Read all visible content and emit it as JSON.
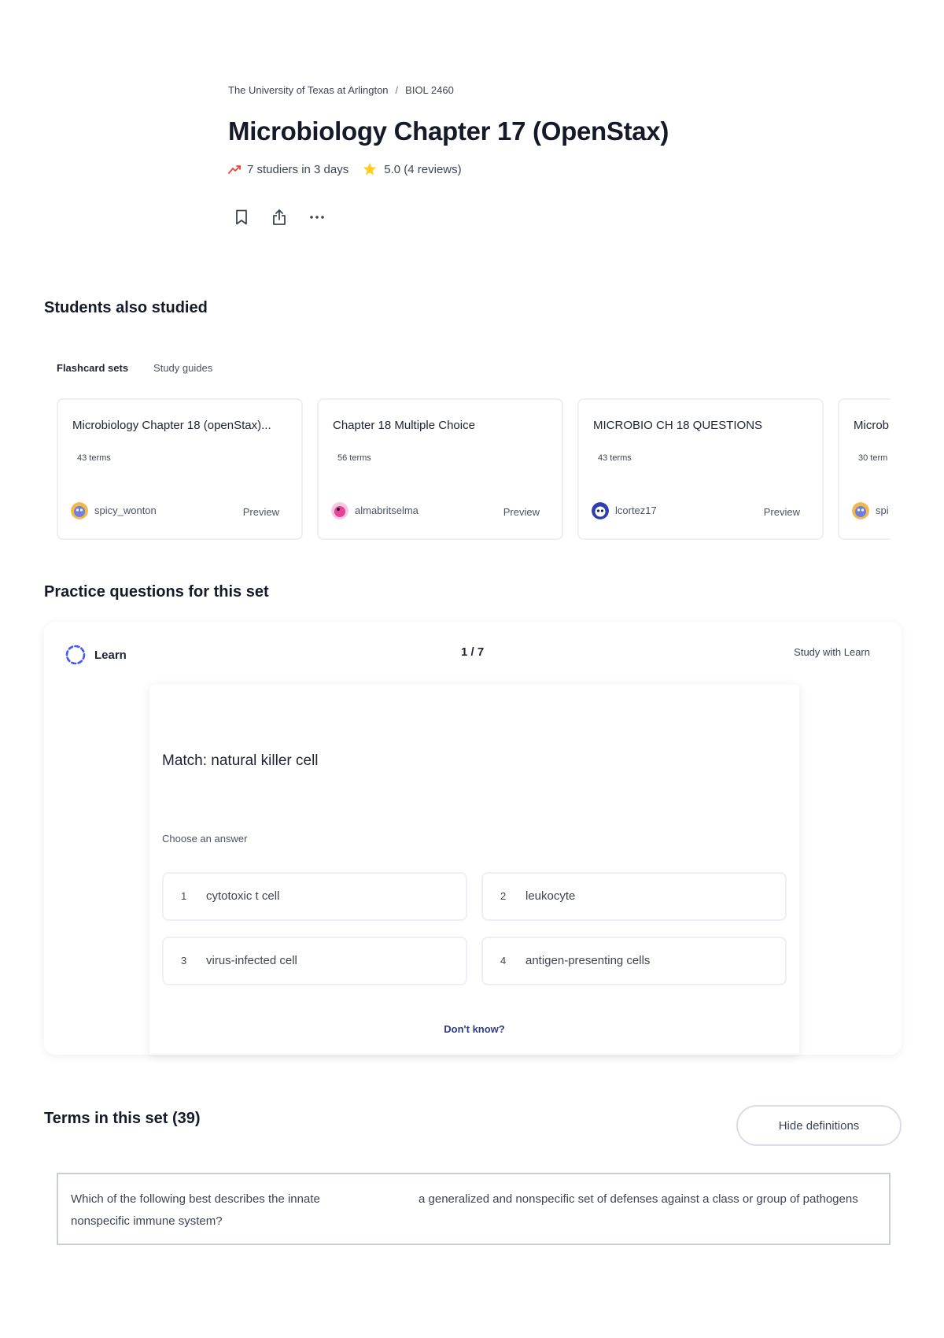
{
  "breadcrumb": {
    "school": "The University of Texas at Arlington",
    "separator": "/",
    "course": "BIOL 2460"
  },
  "page": {
    "title": "Microbiology Chapter 17 (OpenStax)",
    "studiers": "7 studiers in 3 days",
    "rating": "5.0 (4 reviews)"
  },
  "students_also_studied": {
    "title": "Students also studied",
    "tabs": [
      "Flashcard sets",
      "Study guides"
    ],
    "cards": [
      {
        "title": "Microbiology Chapter 18 (openStax)...",
        "terms": "43 terms",
        "user": "spicy_wonton",
        "preview": "Preview"
      },
      {
        "title": "Chapter 18 Multiple Choice",
        "terms": "56 terms",
        "user": "almabritselma",
        "preview": "Preview"
      },
      {
        "title": "MICROBIO CH 18 QUESTIONS",
        "terms": "43 terms",
        "user": "lcortez17",
        "preview": "Preview"
      },
      {
        "title": "Microb",
        "terms": "30 term",
        "user": "spi",
        "preview": ""
      }
    ]
  },
  "practice": {
    "title": "Practice questions for this set",
    "mode": "Learn",
    "progress": "1 / 7",
    "study_link": "Study with Learn",
    "question": "Match: natural killer cell",
    "choose_label": "Choose an answer",
    "options": [
      {
        "num": "1",
        "text": "cytotoxic t cell"
      },
      {
        "num": "2",
        "text": "leukocyte"
      },
      {
        "num": "3",
        "text": "virus-infected cell"
      },
      {
        "num": "4",
        "text": "antigen-presenting cells"
      }
    ],
    "dont_know": "Don't know?"
  },
  "terms": {
    "title": "Terms in this set (39)",
    "hide_button": "Hide definitions",
    "rows": [
      {
        "term": "Which of the following best describes the innate nonspecific immune system?",
        "definition": "a generalized and nonspecific set of defenses against a class or group of pathogens"
      }
    ]
  },
  "colors": {
    "accent": "#4255ff",
    "star": "#ffcd1f",
    "trend": "#e8453c",
    "link": "#2e3b8c"
  },
  "icons": [
    "trending-icon",
    "star-icon",
    "bookmark-icon",
    "share-icon",
    "more-icon",
    "learn-icon"
  ]
}
